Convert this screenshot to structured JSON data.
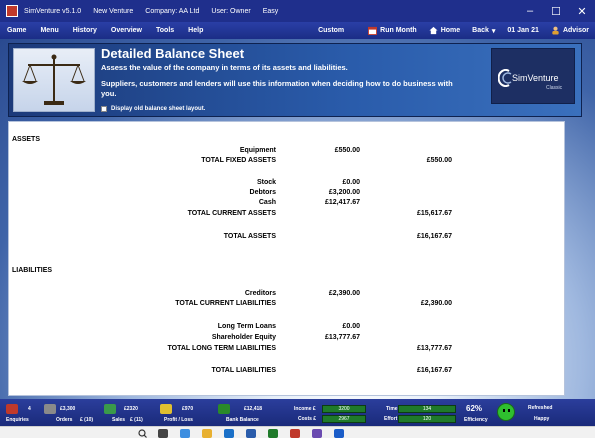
{
  "window": {
    "title_items": [
      "SimVenture v5.1.0",
      "New Venture",
      "Company: AA Ltd",
      "User: Owner",
      "Easy"
    ],
    "minimize": "–",
    "maximize": "☐",
    "close": "✕"
  },
  "menu": {
    "items": [
      "Game",
      "Menu",
      "History",
      "Overview",
      "Tools",
      "Help"
    ],
    "custom": "Custom",
    "run_month": "Run Month",
    "home": "Home",
    "back": "Back",
    "back_arrow": "▾",
    "date": "01 Jan 21",
    "advisor": "Advisor"
  },
  "header": {
    "title": "Detailed Balance Sheet",
    "subtitle": "Assess the value of the company in terms of its assets and liabilities.",
    "description": "Suppliers, customers and lenders will use this information when deciding how to do business with you.",
    "checkbox_label": "Display old balance sheet layout.",
    "logo_name": "SimVenture",
    "logo_tag": "Classic"
  },
  "sheet": {
    "assets_heading": "ASSETS",
    "liabilities_heading": "LIABILITIES",
    "rows": [
      {
        "label": "Equipment",
        "c1": "£550.00",
        "c2": ""
      },
      {
        "label": "TOTAL FIXED ASSETS",
        "c1": "",
        "c2": "£550.00"
      },
      {
        "label": "Stock",
        "c1": "£0.00",
        "c2": ""
      },
      {
        "label": "Debtors",
        "c1": "£3,200.00",
        "c2": ""
      },
      {
        "label": "Cash",
        "c1": "£12,417.67",
        "c2": ""
      },
      {
        "label": "TOTAL CURRENT ASSETS",
        "c1": "",
        "c2": "£15,617.67"
      },
      {
        "label": "TOTAL ASSETS",
        "c1": "",
        "c2": "£16,167.67"
      },
      {
        "label": "Creditors",
        "c1": "£2,390.00",
        "c2": ""
      },
      {
        "label": "TOTAL CURRENT LIABILITIES",
        "c1": "",
        "c2": "£2,390.00"
      },
      {
        "label": "Long Term Loans",
        "c1": "£0.00",
        "c2": ""
      },
      {
        "label": "Shareholder Equity",
        "c1": "£13,777.67",
        "c2": ""
      },
      {
        "label": "TOTAL LONG TERM LIABILITIES",
        "c1": "",
        "c2": "£13,777.67"
      },
      {
        "label": "TOTAL LIABILITIES",
        "c1": "",
        "c2": "£16,167.67"
      }
    ]
  },
  "status": {
    "enquiries_value": "4",
    "enquiries_label": "Enquiries",
    "orders_value": "£3,300",
    "orders_label": "Orders",
    "orders_sub": "£ (10)",
    "sales_value": "£2320",
    "sales_label": "Sales",
    "sales_sub": "£ (11)",
    "profit_value": "£970",
    "profit_label": "Profit / Loss",
    "bank_value": "£12,418",
    "bank_label": "Bank Balance",
    "income_label": "Income £",
    "income_value": "3200",
    "costs_label": "Costs £",
    "costs_value": "2967",
    "time_label": "Time",
    "time_value": "134",
    "effort_label": "Effort",
    "effort_value": "120",
    "efficiency_value": "62%",
    "efficiency_label": "Efficiency",
    "mood_label": "Refreshed",
    "mood_value": "Happy"
  },
  "colors": {
    "titlebar": "#1f2f8c",
    "menubar": "#2a3fa6",
    "header_panel": "#2a5cab",
    "status_green": "#1f7a2a"
  }
}
